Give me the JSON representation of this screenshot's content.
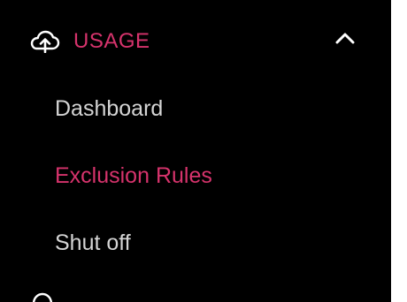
{
  "sidebar": {
    "section": {
      "label": "USAGE",
      "icon": "cloud-upload-icon",
      "expanded_icon": "chevron-up-icon",
      "expanded": true
    },
    "items": [
      {
        "label": "Dashboard",
        "active": false
      },
      {
        "label": "Exclusion Rules",
        "active": true
      },
      {
        "label": "Shut off",
        "active": false
      }
    ],
    "next_section_icon": "partial-icon"
  },
  "colors": {
    "background": "#000000",
    "accent": "#d6336c",
    "text": "#d4d4d4",
    "icon": "#ffffff"
  }
}
